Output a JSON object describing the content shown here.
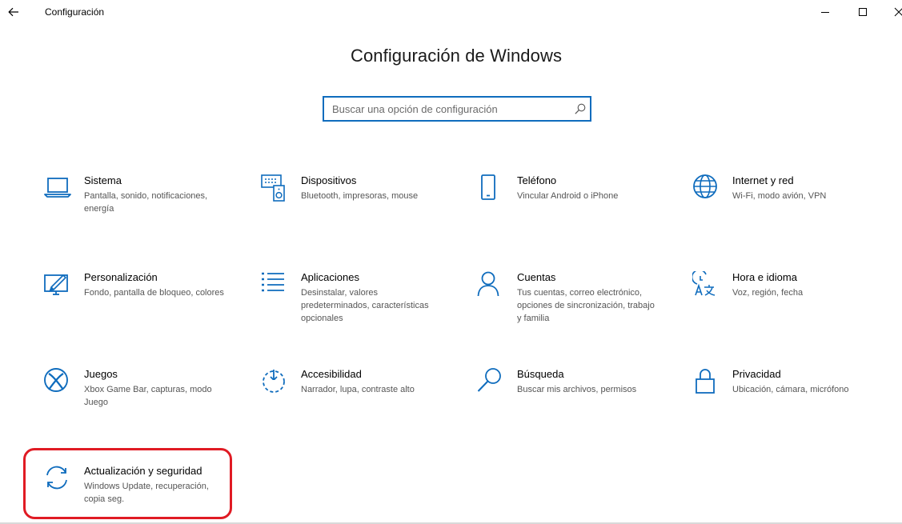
{
  "window": {
    "title": "Configuración"
  },
  "header": {
    "title": "Configuración de Windows"
  },
  "search": {
    "placeholder": "Buscar una opción de configuración"
  },
  "colors": {
    "accent": "#0f6cbd",
    "highlight": "#e01b24"
  },
  "tiles": [
    {
      "title": "Sistema",
      "desc": "Pantalla, sonido, notificaciones, energía",
      "icon": "laptop-icon"
    },
    {
      "title": "Dispositivos",
      "desc": "Bluetooth, impresoras, mouse",
      "icon": "devices-icon"
    },
    {
      "title": "Teléfono",
      "desc": "Vincular Android o iPhone",
      "icon": "phone-icon"
    },
    {
      "title": "Internet y red",
      "desc": "Wi-Fi, modo avión, VPN",
      "icon": "globe-icon"
    },
    {
      "title": "Personalización",
      "desc": "Fondo, pantalla de bloqueo, colores",
      "icon": "personalization-icon"
    },
    {
      "title": "Aplicaciones",
      "desc": "Desinstalar, valores predeterminados, características opcionales",
      "icon": "apps-list-icon"
    },
    {
      "title": "Cuentas",
      "desc": "Tus cuentas, correo electrónico, opciones de sincronización, trabajo y familia",
      "icon": "person-icon"
    },
    {
      "title": "Hora e idioma",
      "desc": "Voz, región, fecha",
      "icon": "time-language-icon"
    },
    {
      "title": "Juegos",
      "desc": "Xbox Game Bar, capturas, modo Juego",
      "icon": "xbox-icon"
    },
    {
      "title": "Accesibilidad",
      "desc": "Narrador, lupa, contraste alto",
      "icon": "accessibility-icon"
    },
    {
      "title": "Búsqueda",
      "desc": "Buscar mis archivos, permisos",
      "icon": "magnifier-icon"
    },
    {
      "title": "Privacidad",
      "desc": "Ubicación, cámara, micrófono",
      "icon": "lock-icon"
    },
    {
      "title": "Actualización y seguridad",
      "desc": "Windows Update, recuperación, copia seg.",
      "icon": "sync-icon"
    }
  ]
}
